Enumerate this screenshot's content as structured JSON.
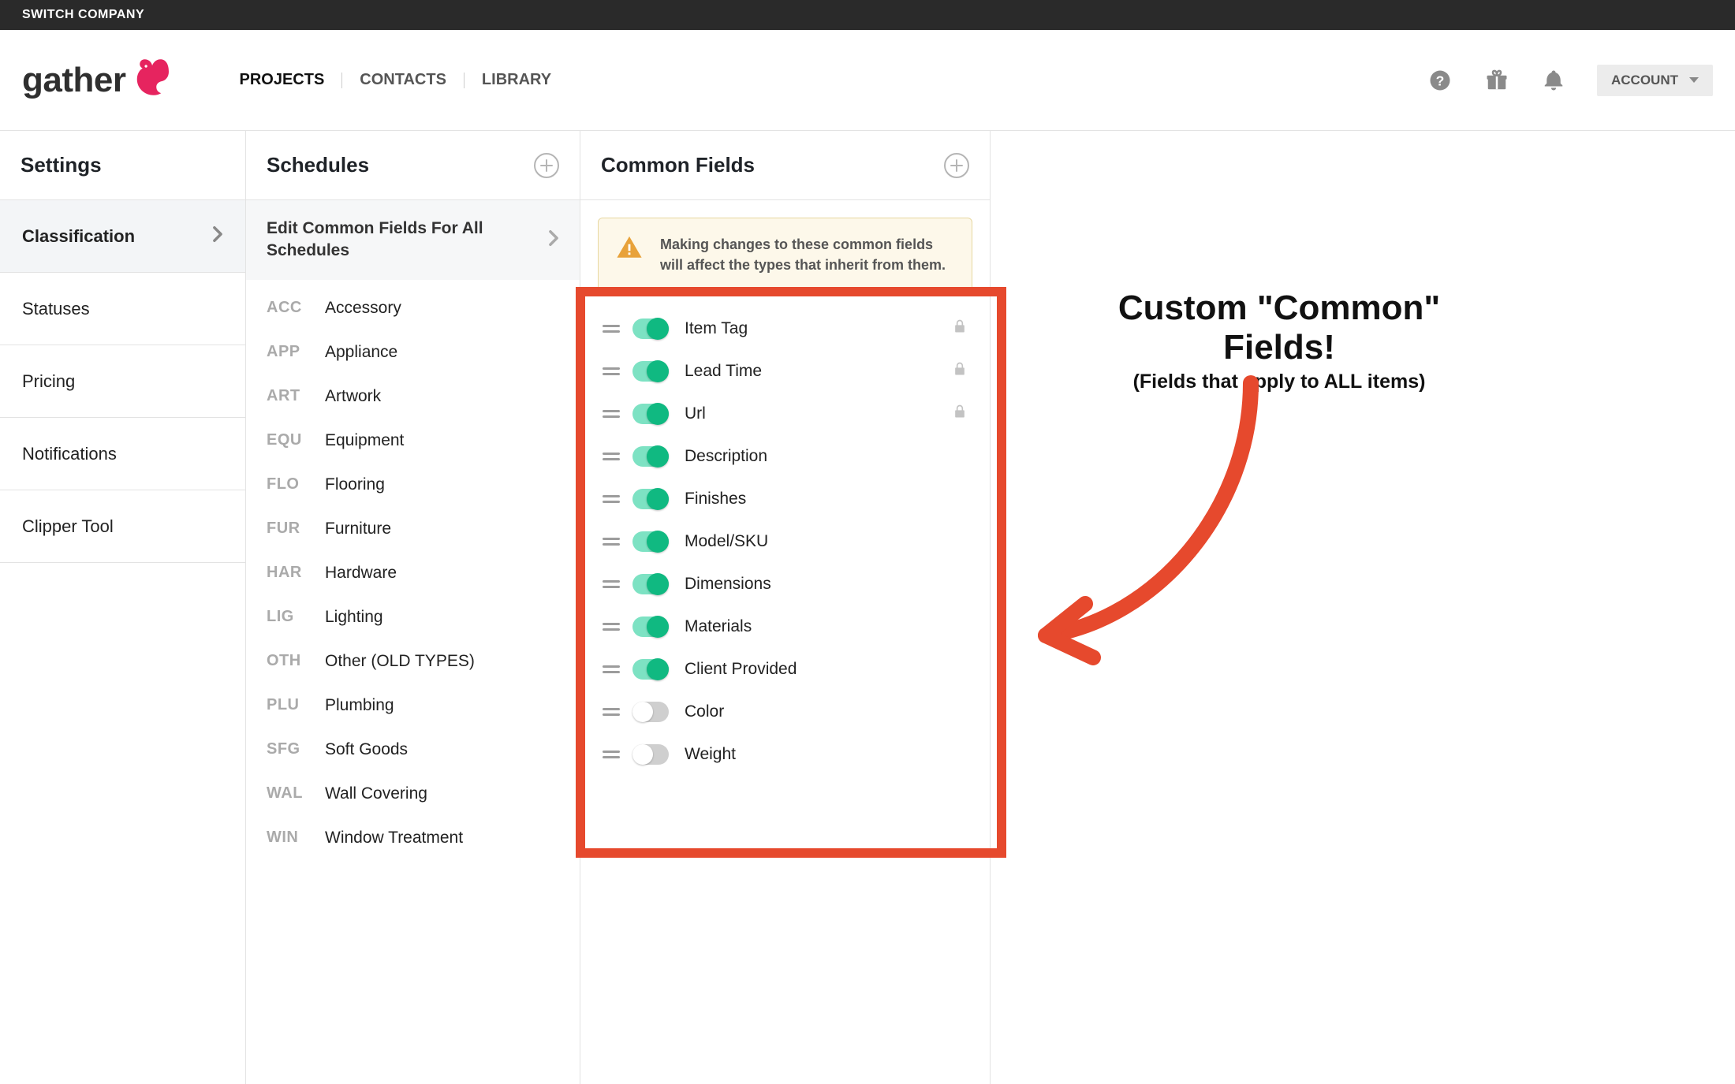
{
  "topbar": {
    "switch": "SWITCH COMPANY"
  },
  "brand": {
    "name": "gather"
  },
  "nav": {
    "projects": "PROJECTS",
    "contacts": "CONTACTS",
    "library": "LIBRARY"
  },
  "account": {
    "label": "ACCOUNT"
  },
  "settings": {
    "title": "Settings",
    "items": [
      {
        "label": "Classification",
        "active": true,
        "chev": true
      },
      {
        "label": "Statuses"
      },
      {
        "label": "Pricing"
      },
      {
        "label": "Notifications"
      },
      {
        "label": "Clipper Tool"
      }
    ]
  },
  "schedules": {
    "title": "Schedules",
    "edit_label": "Edit Common Fields For All Schedules",
    "items": [
      {
        "code": "ACC",
        "name": "Accessory"
      },
      {
        "code": "APP",
        "name": "Appliance"
      },
      {
        "code": "ART",
        "name": "Artwork"
      },
      {
        "code": "EQU",
        "name": "Equipment"
      },
      {
        "code": "FLO",
        "name": "Flooring"
      },
      {
        "code": "FUR",
        "name": "Furniture"
      },
      {
        "code": "HAR",
        "name": "Hardware"
      },
      {
        "code": "LIG",
        "name": "Lighting"
      },
      {
        "code": "OTH",
        "name": "Other (OLD TYPES)"
      },
      {
        "code": "PLU",
        "name": "Plumbing"
      },
      {
        "code": "SFG",
        "name": "Soft Goods"
      },
      {
        "code": "WAL",
        "name": "Wall Covering"
      },
      {
        "code": "WIN",
        "name": "Window Treatment"
      }
    ]
  },
  "common_fields": {
    "title": "Common Fields",
    "warning": "Making changes to these common fields will affect the types that inherit from them.",
    "fields": [
      {
        "label": "Item Tag",
        "on": true,
        "locked": true
      },
      {
        "label": "Lead Time",
        "on": true,
        "locked": true
      },
      {
        "label": "Url",
        "on": true,
        "locked": true
      },
      {
        "label": "Description",
        "on": true,
        "locked": false
      },
      {
        "label": "Finishes",
        "on": true,
        "locked": false
      },
      {
        "label": "Model/SKU",
        "on": true,
        "locked": false
      },
      {
        "label": "Dimensions",
        "on": true,
        "locked": false
      },
      {
        "label": "Materials",
        "on": true,
        "locked": false
      },
      {
        "label": "Client Provided",
        "on": true,
        "locked": false
      },
      {
        "label": "Color",
        "on": false,
        "locked": false
      },
      {
        "label": "Weight",
        "on": false,
        "locked": false
      }
    ]
  },
  "annotation": {
    "title": "Custom \"Common\" Fields!",
    "subtitle": "(Fields that apply to ALL items)"
  }
}
